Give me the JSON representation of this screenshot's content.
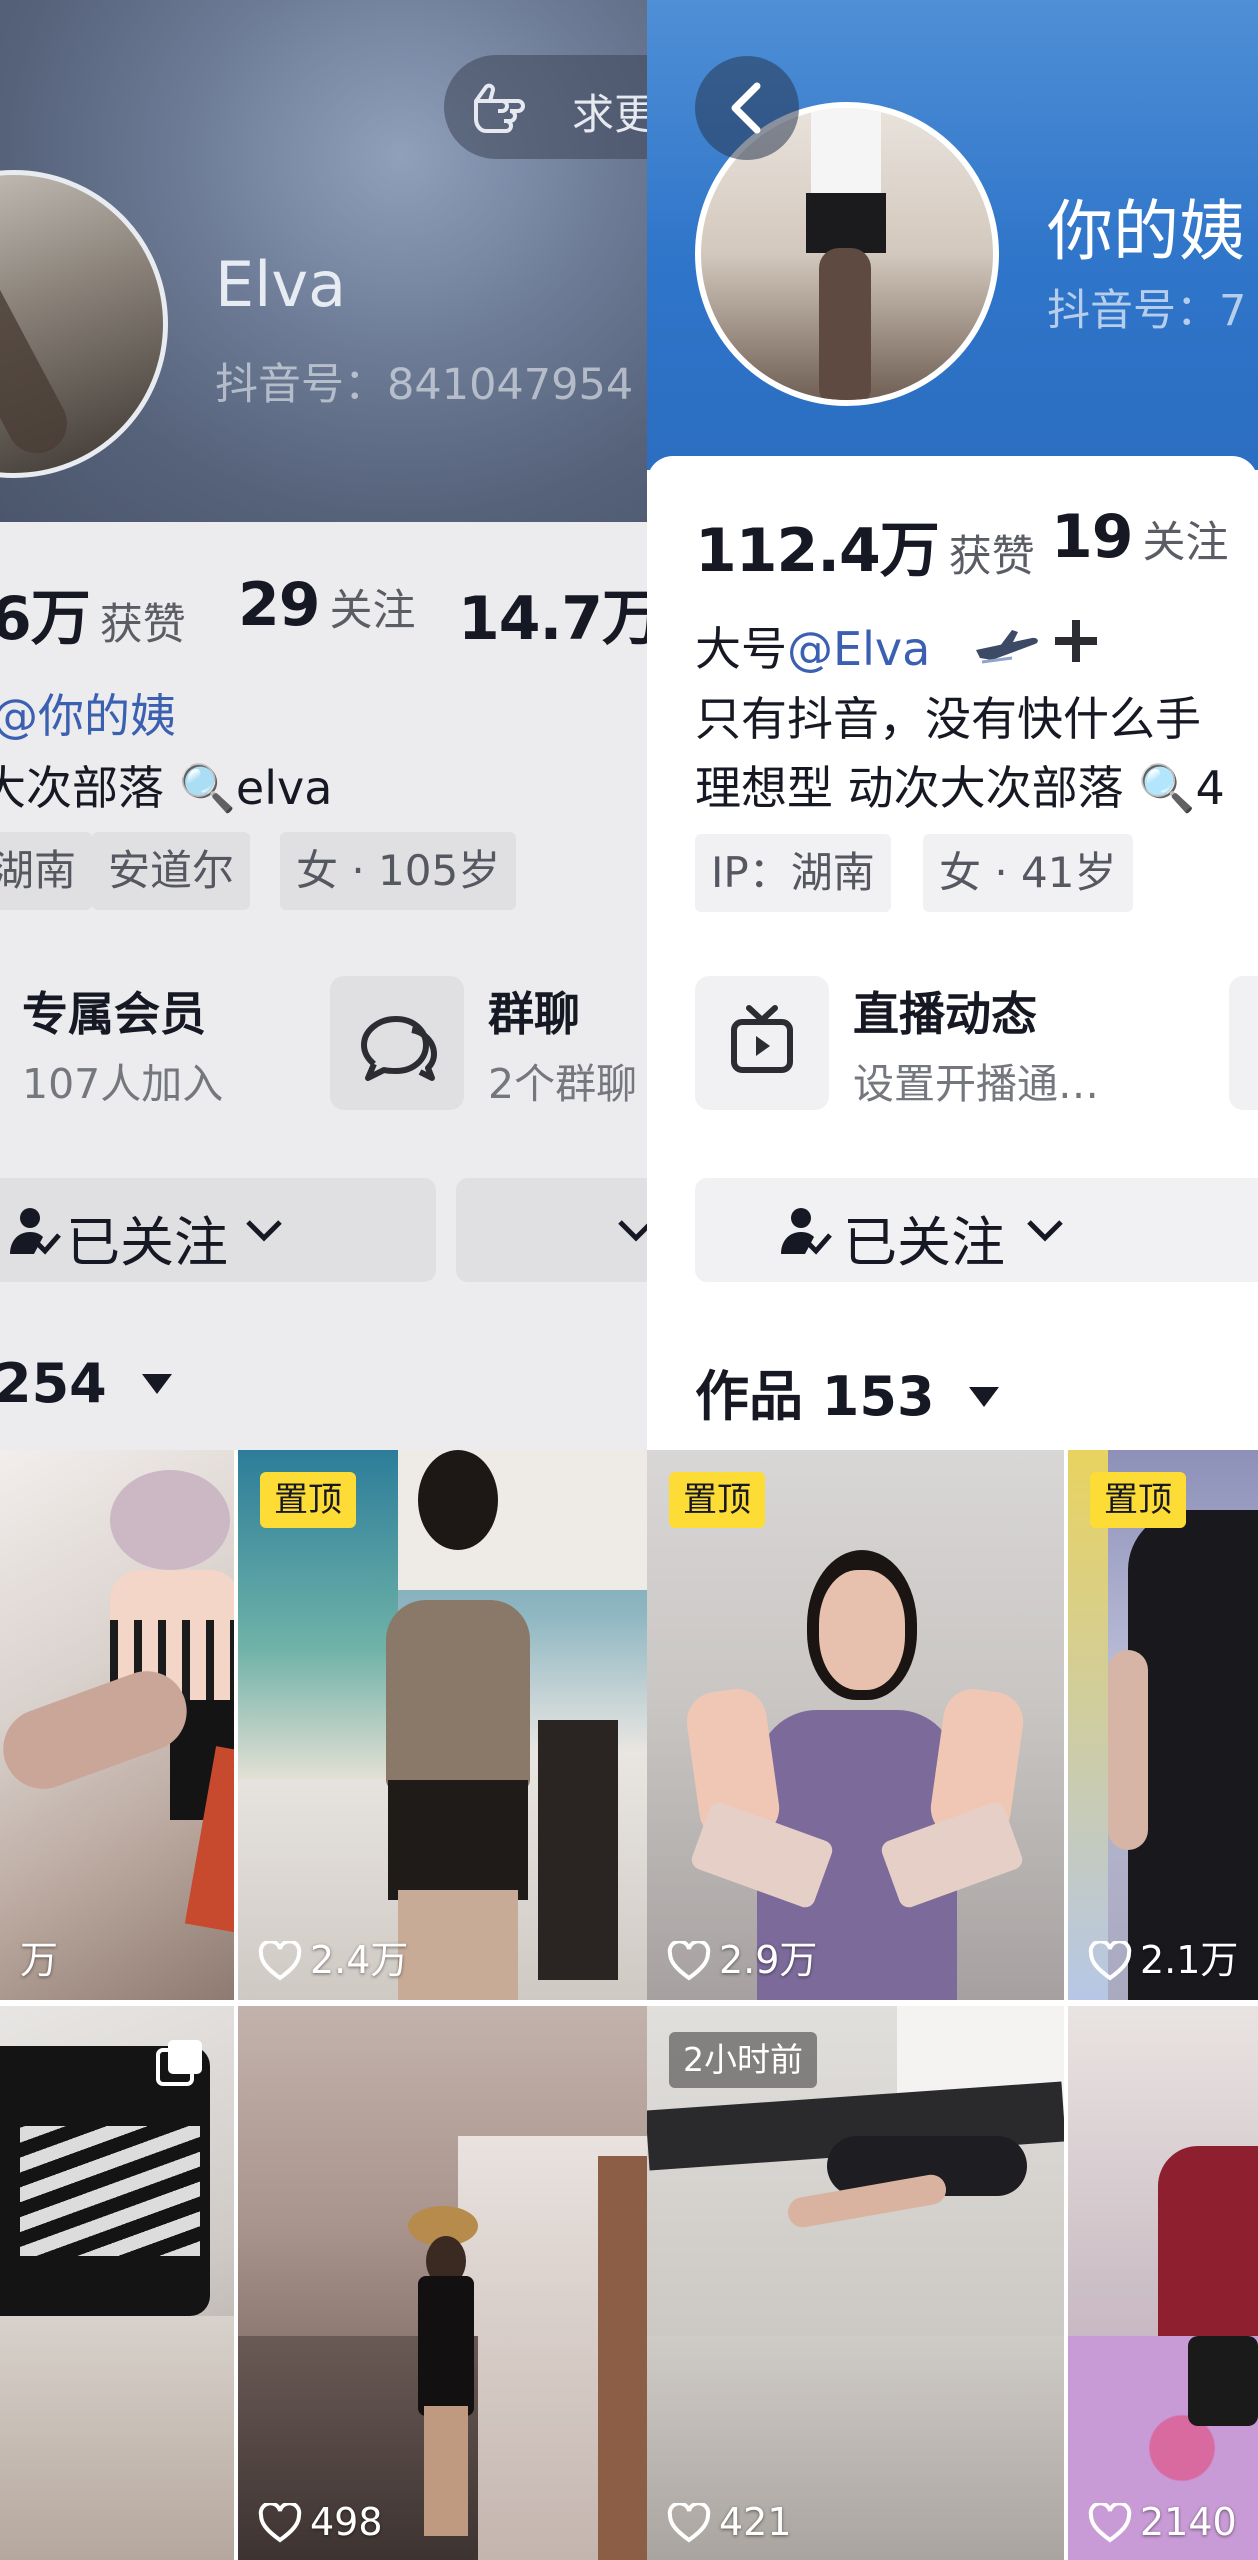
{
  "left_profile": {
    "wish_button": "求更",
    "nickname": "Elva",
    "douyin_id": "抖音号：841047954",
    "stats": [
      {
        "value": "6万",
        "label": "获赞"
      },
      {
        "value": "29",
        "label": "关注"
      },
      {
        "value": "14.7万",
        "label": ""
      }
    ],
    "linked_account": "@你的姨",
    "bio": "大次部落 🔍elva",
    "tags": [
      "湖南",
      "安道尔",
      "女 · 105岁"
    ],
    "membership": {
      "title": "专属会员",
      "subtitle": "107人加入"
    },
    "group_chat": {
      "title": "群聊",
      "subtitle": "2个群聊"
    },
    "follow_button": "已关注",
    "works_count": "254"
  },
  "right_profile": {
    "nickname": "你的姨",
    "douyin_id": "抖音号：7",
    "stats": [
      {
        "value": "112.4万",
        "label": "获赞"
      },
      {
        "value": "19",
        "label": "关注"
      }
    ],
    "bio_line1_prefix": "大号",
    "bio_line1_mention": "@Elva",
    "bio_line2": "只有抖音，没有快什么手",
    "bio_line3": "理想型  动次大次部落 🔍4",
    "tags": [
      "IP：湖南",
      "女 · 41岁"
    ],
    "live": {
      "title": "直播动态",
      "subtitle": "设置开播通…"
    },
    "follow_button": "已关注",
    "works_label": "作品 153"
  },
  "videos": [
    {
      "panel": "left",
      "likes": "万",
      "pinned": false
    },
    {
      "panel": "left",
      "likes": "2.4万",
      "pinned": true,
      "pin_label": "置顶"
    },
    {
      "panel": "left",
      "likes": "",
      "pinned": false
    },
    {
      "panel": "left",
      "likes": "498",
      "pinned": false
    },
    {
      "panel": "right",
      "likes": "2.9万",
      "pinned": true,
      "pin_label": "置顶"
    },
    {
      "panel": "right",
      "likes": "2.1万",
      "pinned": true,
      "pin_label": "置顶"
    },
    {
      "panel": "right",
      "likes": "421",
      "pinned": false,
      "time_badge": "2小时前"
    },
    {
      "panel": "right",
      "likes": "2140",
      "pinned": false
    }
  ],
  "icons": [
    "hand-point-icon",
    "back-arrow-icon",
    "chat-bubble-icon",
    "tv-icon",
    "user-check-icon",
    "chevron-down-icon",
    "triangle-down-icon",
    "heart-icon",
    "search-icon",
    "plane-icon",
    "plus-icon",
    "multi-image-icon"
  ],
  "colors": {
    "accent_link": "#3b5fb1",
    "pin_badge": "#fddd35",
    "right_header": "#2f75c9",
    "left_header": "#6d7b96"
  }
}
